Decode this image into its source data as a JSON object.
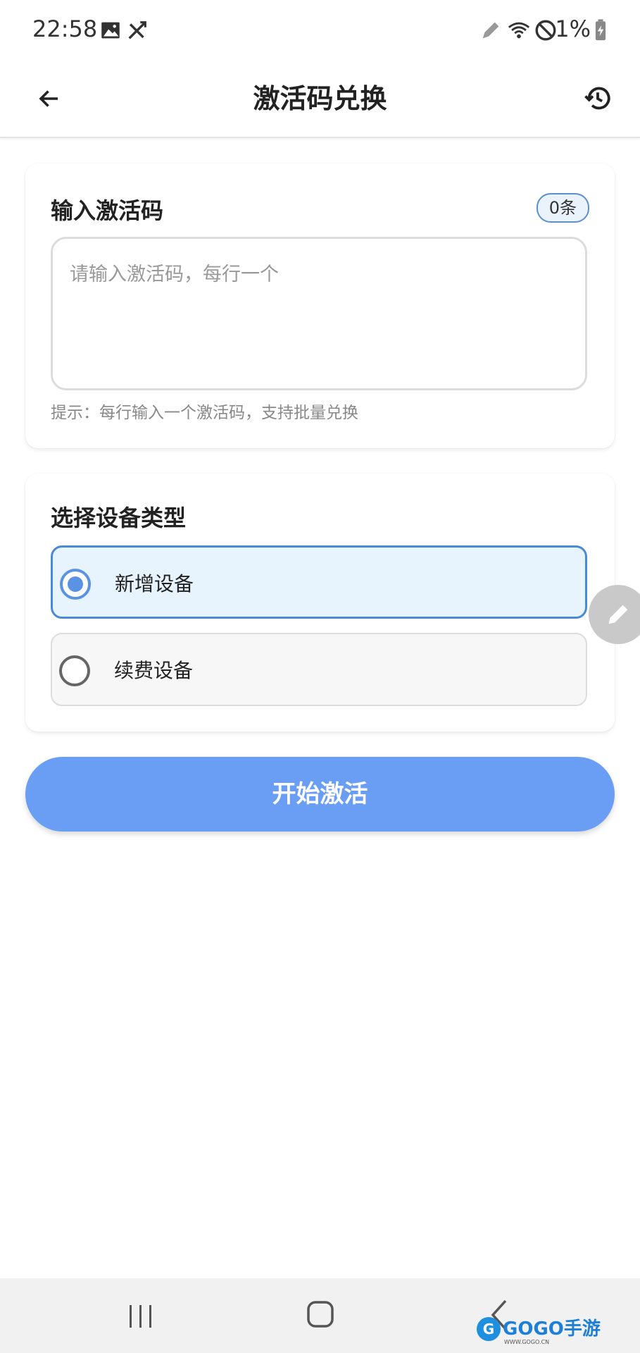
{
  "status_bar": {
    "time": "22:58",
    "battery": "1%",
    "icons": [
      "image-icon",
      "no-sync-icon",
      "edit-pen-icon",
      "wifi-icon",
      "do-not-disturb-icon",
      "battery-charging-icon"
    ]
  },
  "app_bar": {
    "title": "激活码兑换",
    "back_icon": "back-arrow-icon",
    "history_icon": "history-icon"
  },
  "code_card": {
    "title": "输入激活码",
    "count_badge": "0条",
    "input_placeholder": "请输入激活码，每行一个",
    "input_value": "",
    "hint": "提示：每行输入一个激活码，支持批量兑换"
  },
  "device_card": {
    "title": "选择设备类型",
    "options": [
      {
        "label": "新增设备",
        "selected": true
      },
      {
        "label": "续费设备",
        "selected": false
      }
    ]
  },
  "floating_button": {
    "icon": "pencil-icon"
  },
  "start_button": {
    "label": "开始激活"
  },
  "colors": {
    "accent": "#6a9ef5",
    "radio_selected": "#5b93e4",
    "selected_bg": "#e8f4fd",
    "selected_border": "#4a8ad3"
  },
  "nav_bar": {
    "watermark": "GOGO手游网",
    "watermark_sub": "WWW.GOGO.CN"
  }
}
